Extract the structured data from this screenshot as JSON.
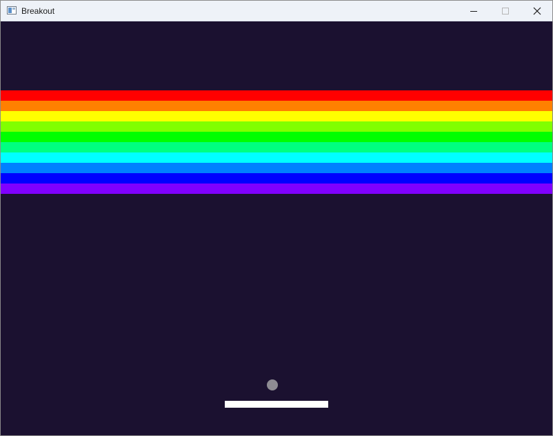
{
  "window": {
    "title": "Breakout",
    "app_icon": "window-app-icon",
    "controls": [
      "minimize-icon",
      "maximize-icon",
      "close-icon"
    ]
  },
  "game": {
    "background_color": "#1b1130",
    "brick_rows": [
      {
        "color": "#ff0000"
      },
      {
        "color": "#ff8000"
      },
      {
        "color": "#ffff00"
      },
      {
        "color": "#80ff00"
      },
      {
        "color": "#00ff00"
      },
      {
        "color": "#00ff80"
      },
      {
        "color": "#00ffff"
      },
      {
        "color": "#0080ff"
      },
      {
        "color": "#0000ff"
      },
      {
        "color": "#8000ff"
      }
    ],
    "ball_color": "#8e8c93",
    "paddle_color": "#ffffff"
  }
}
